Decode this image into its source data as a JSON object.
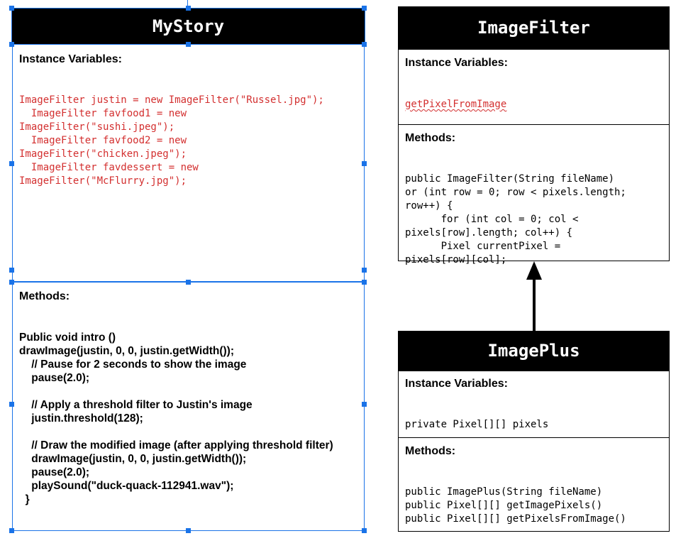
{
  "boxes": {
    "mystory": {
      "title": "MyStory",
      "instance_label": "Instance Variables:",
      "instance_lines": [
        "ImageFilter justin = new ImageFilter(\"Russel.jpg\");",
        "  ImageFilter favfood1 = new",
        "ImageFilter(\"sushi.jpeg\");",
        "  ImageFilter favfood2 = new",
        "ImageFilter(\"chicken.jpeg\");",
        "  ImageFilter favdessert = new",
        "ImageFilter(\"McFlurry.jpg\");"
      ],
      "methods_label": "Methods:",
      "method_lines": [
        "Public void intro ()",
        "drawImage(justin, 0, 0, justin.getWidth());",
        "    // Pause for 2 seconds to show the image",
        "    pause(2.0);",
        "",
        "    // Apply a threshold filter to Justin's image",
        "    justin.threshold(128);",
        "",
        "    // Draw the modified image (after applying threshold filter)",
        "    drawImage(justin, 0, 0, justin.getWidth());",
        "    pause(2.0);",
        "    playSound(\"duck-quack-112941.wav\");",
        "  }"
      ]
    },
    "imagefilter": {
      "title": "ImageFilter",
      "instance_label": "Instance Variables:",
      "instance_lines": [
        "getPixelFromImage"
      ],
      "methods_label": "Methods:",
      "method_lines": [
        "public ImageFilter(String fileName)",
        "or (int row = 0; row < pixels.length;",
        "row++) {",
        "      for (int col = 0; col <",
        "pixels[row].length; col++) {",
        "      Pixel currentPixel =",
        "pixels[row][col];"
      ]
    },
    "imageplus": {
      "title": "ImagePlus",
      "instance_label": "Instance Variables:",
      "instance_lines": [
        "private Pixel[][] pixels"
      ],
      "methods_label": "Methods:",
      "method_lines": [
        "public ImagePlus(String fileName)",
        "public Pixel[][] getImagePixels()",
        "public Pixel[][] getPixelsFromImage()"
      ]
    }
  },
  "colors": {
    "code_red": "#d32f2f",
    "selection": "#1a73e8",
    "header_bg": "#000000"
  },
  "icons": {
    "arrow": "inheritance-arrow-icon"
  }
}
